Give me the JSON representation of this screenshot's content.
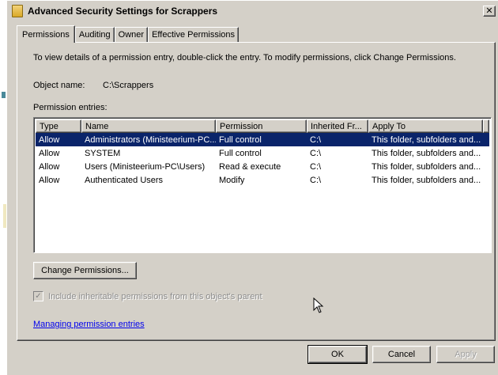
{
  "window": {
    "title": "Advanced Security Settings for Scrappers",
    "close_glyph": "✕"
  },
  "tabs": [
    {
      "label": "Permissions",
      "active": true
    },
    {
      "label": "Auditing",
      "active": false
    },
    {
      "label": "Owner",
      "active": false
    },
    {
      "label": "Effective Permissions",
      "active": false
    }
  ],
  "panel": {
    "info_text": "To view details of a permission entry, double-click the entry. To modify permissions, click Change Permissions.",
    "object_name_label": "Object name:",
    "object_name_value": "C:\\Scrappers",
    "entries_label": "Permission entries:"
  },
  "table": {
    "columns": [
      "Type",
      "Name",
      "Permission",
      "Inherited Fr...",
      "Apply To"
    ],
    "rows": [
      {
        "type": "Allow",
        "name": "Administrators (Ministeerium-PC...",
        "permission": "Full control",
        "inherited": "C:\\",
        "apply": "This folder, subfolders and...",
        "selected": true
      },
      {
        "type": "Allow",
        "name": "SYSTEM",
        "permission": "Full control",
        "inherited": "C:\\",
        "apply": "This folder, subfolders and...",
        "selected": false
      },
      {
        "type": "Allow",
        "name": "Users (Ministeerium-PC\\Users)",
        "permission": "Read & execute",
        "inherited": "C:\\",
        "apply": "This folder, subfolders and...",
        "selected": false
      },
      {
        "type": "Allow",
        "name": "Authenticated Users",
        "permission": "Modify",
        "inherited": "C:\\",
        "apply": "This folder, subfolders and...",
        "selected": false
      }
    ]
  },
  "change_permissions_label": "Change Permissions...",
  "inherit_checkbox": {
    "label": "Include inheritable permissions from this object's parent",
    "checked": true,
    "disabled": true,
    "check_glyph": "✓"
  },
  "help_link": "Managing permission entries",
  "footer": {
    "ok_label": "OK",
    "cancel_label": "Cancel",
    "apply_label": "Apply"
  },
  "colors": {
    "dialog_bg": "#d4d0c8",
    "selection": "#0a246a",
    "link": "#0000ee"
  }
}
